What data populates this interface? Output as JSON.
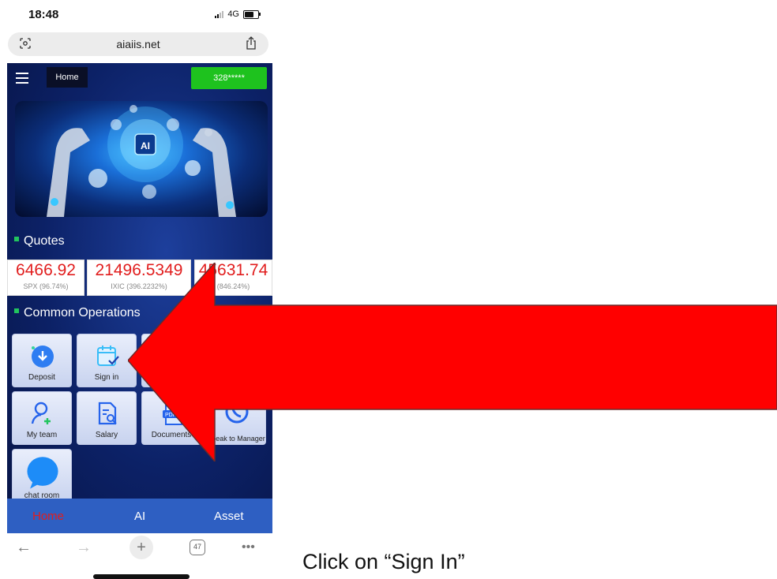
{
  "status_bar": {
    "time": "18:48",
    "network": "4G"
  },
  "browser": {
    "url": "aiaiis.net",
    "tab_count": "47"
  },
  "app": {
    "header": {
      "home_label": "Home",
      "account": "328*****"
    },
    "quotes_title": "Quotes",
    "quotes": [
      {
        "value": "6466.92",
        "label": "SPX (96.74%)"
      },
      {
        "value": "21496.5349",
        "label": "IXIC (396.2232%)"
      },
      {
        "value": "45631.74",
        "label": "(846.24%)"
      }
    ],
    "operations_title": "Common Operations",
    "operations": [
      {
        "label": "Deposit",
        "icon": "cloud-download-icon"
      },
      {
        "label": "Sign in",
        "icon": "calendar-check-icon"
      },
      {
        "label": "My team",
        "icon": "add-user-icon"
      },
      {
        "label": "Salary",
        "icon": "document-search-icon"
      },
      {
        "label": "Documents",
        "icon": "pdf-icon"
      },
      {
        "label": "Speak to Manager",
        "icon": "whatsapp-icon"
      },
      {
        "label": "chat room",
        "icon": "chat-bubble-icon"
      }
    ],
    "bottom_nav": [
      {
        "label": "Home",
        "active": true
      },
      {
        "label": "AI",
        "active": false
      },
      {
        "label": "Asset",
        "active": false
      }
    ]
  },
  "annotation": {
    "caption": "Click on “Sign In”",
    "arrow_color": "#ff0000"
  },
  "colors": {
    "app_bg": "#0c2166",
    "account_green": "#1ec21e",
    "nav_blue": "#2e5fc2",
    "quote_red": "#e11d1d"
  }
}
